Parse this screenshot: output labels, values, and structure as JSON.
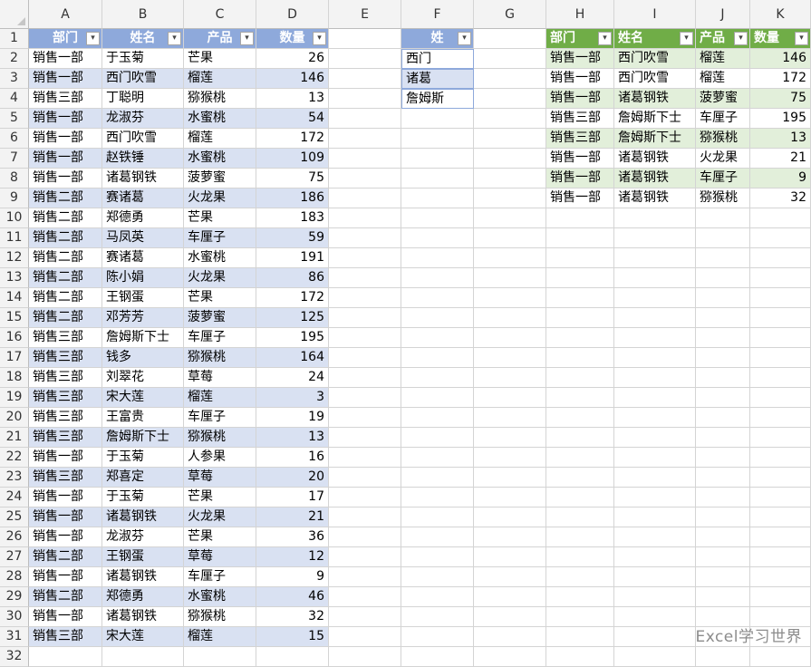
{
  "columns": [
    "A",
    "B",
    "C",
    "D",
    "E",
    "F",
    "G",
    "H",
    "I",
    "J",
    "K"
  ],
  "rows": [
    "1",
    "2",
    "3",
    "4",
    "5",
    "6",
    "7",
    "8",
    "9",
    "10",
    "11",
    "12",
    "13",
    "14",
    "15",
    "16",
    "17",
    "18",
    "19",
    "20",
    "21",
    "22",
    "23",
    "24",
    "25",
    "26",
    "27",
    "28",
    "29",
    "30",
    "31",
    "32"
  ],
  "source_table": {
    "headers": [
      "部门",
      "姓名",
      "产品",
      "数量"
    ],
    "rows": [
      [
        "销售一部",
        "于玉菊",
        "芒果",
        "26"
      ],
      [
        "销售一部",
        "西门吹雪",
        "榴莲",
        "146"
      ],
      [
        "销售三部",
        "丁聪明",
        "猕猴桃",
        "13"
      ],
      [
        "销售一部",
        "龙淑芬",
        "水蜜桃",
        "54"
      ],
      [
        "销售一部",
        "西门吹雪",
        "榴莲",
        "172"
      ],
      [
        "销售一部",
        "赵铁锤",
        "水蜜桃",
        "109"
      ],
      [
        "销售一部",
        "诸葛钢铁",
        "菠萝蜜",
        "75"
      ],
      [
        "销售二部",
        "赛诸葛",
        "火龙果",
        "186"
      ],
      [
        "销售二部",
        "郑德勇",
        "芒果",
        "183"
      ],
      [
        "销售二部",
        "马凤英",
        "车厘子",
        "59"
      ],
      [
        "销售二部",
        "赛诸葛",
        "水蜜桃",
        "191"
      ],
      [
        "销售二部",
        "陈小娟",
        "火龙果",
        "86"
      ],
      [
        "销售二部",
        "王钢蛋",
        "芒果",
        "172"
      ],
      [
        "销售二部",
        "邓芳芳",
        "菠萝蜜",
        "125"
      ],
      [
        "销售三部",
        "詹姆斯下士",
        "车厘子",
        "195"
      ],
      [
        "销售三部",
        "钱多",
        "猕猴桃",
        "164"
      ],
      [
        "销售三部",
        "刘翠花",
        "草莓",
        "24"
      ],
      [
        "销售三部",
        "宋大莲",
        "榴莲",
        "3"
      ],
      [
        "销售三部",
        "王富贵",
        "车厘子",
        "19"
      ],
      [
        "销售三部",
        "詹姆斯下士",
        "猕猴桃",
        "13"
      ],
      [
        "销售一部",
        "于玉菊",
        "人参果",
        "16"
      ],
      [
        "销售三部",
        "郑喜定",
        "草莓",
        "20"
      ],
      [
        "销售一部",
        "于玉菊",
        "芒果",
        "17"
      ],
      [
        "销售一部",
        "诸葛钢铁",
        "火龙果",
        "21"
      ],
      [
        "销售一部",
        "龙淑芬",
        "芒果",
        "36"
      ],
      [
        "销售二部",
        "王钢蛋",
        "草莓",
        "12"
      ],
      [
        "销售一部",
        "诸葛钢铁",
        "车厘子",
        "9"
      ],
      [
        "销售二部",
        "郑德勇",
        "水蜜桃",
        "46"
      ],
      [
        "销售一部",
        "诸葛钢铁",
        "猕猴桃",
        "32"
      ],
      [
        "销售三部",
        "宋大莲",
        "榴莲",
        "15"
      ]
    ]
  },
  "criteria_table": {
    "header": "姓",
    "rows": [
      "西门",
      "诸葛",
      "詹姆斯"
    ]
  },
  "result_table": {
    "headers": [
      "部门",
      "姓名",
      "产品",
      "数量"
    ],
    "rows": [
      [
        "销售一部",
        "西门吹雪",
        "榴莲",
        "146"
      ],
      [
        "销售一部",
        "西门吹雪",
        "榴莲",
        "172"
      ],
      [
        "销售一部",
        "诸葛钢铁",
        "菠萝蜜",
        "75"
      ],
      [
        "销售三部",
        "詹姆斯下士",
        "车厘子",
        "195"
      ],
      [
        "销售三部",
        "詹姆斯下士",
        "猕猴桃",
        "13"
      ],
      [
        "销售一部",
        "诸葛钢铁",
        "火龙果",
        "21"
      ],
      [
        "销售一部",
        "诸葛钢铁",
        "车厘子",
        "9"
      ],
      [
        "销售一部",
        "诸葛钢铁",
        "猕猴桃",
        "32"
      ]
    ]
  },
  "dropdown_glyph": "▾",
  "watermark": "Excel学习世界",
  "colors": {
    "blue_header": "#8ea9db",
    "blue_band": "#d9e1f2",
    "green_header": "#70ad47",
    "green_band": "#e2efda",
    "grid": "#d4d4d4"
  }
}
